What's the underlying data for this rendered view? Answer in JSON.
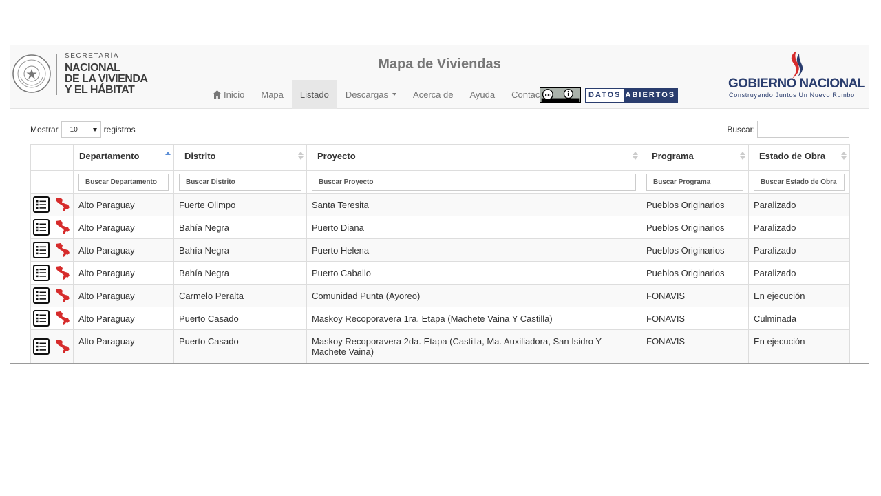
{
  "header": {
    "logo_small": "SECRETARÍA",
    "logo_line1": "NACIONAL",
    "logo_line2": "DE LA VIVIENDA",
    "logo_line3": "Y EL HÁBITAT",
    "title": "Mapa de Viviendas",
    "gob_logo_text": "GOBIERNO NACIONAL",
    "gob_logo_sub": "Construyendo Juntos Un Nuevo Rumbo",
    "datos_1": "DATOS",
    "datos_2": "ABIERTOS"
  },
  "nav": {
    "inicio": "Inicio",
    "mapa": "Mapa",
    "listado": "Listado",
    "descargas": "Descargas",
    "acerca": "Acerca de",
    "ayuda": "Ayuda",
    "contacto": "Contacto"
  },
  "controls": {
    "show_label": "Mostrar",
    "show_value": "10",
    "records_label": "registros",
    "search_label": "Buscar:"
  },
  "table": {
    "headers": [
      "Departamento",
      "Distrito",
      "Proyecto",
      "Programa",
      "Estado de Obra"
    ],
    "search_placeholders": [
      "Buscar Departamento",
      "Buscar Distrito",
      "Buscar Proyecto",
      "Buscar Programa",
      "Buscar Estado de Obra"
    ],
    "rows": [
      {
        "departamento": "Alto Paraguay",
        "distrito": "Fuerte Olimpo",
        "proyecto": "Santa Teresita",
        "programa": "Pueblos Originarios",
        "estado": "Paralizado"
      },
      {
        "departamento": "Alto Paraguay",
        "distrito": "Bahía Negra",
        "proyecto": "Puerto Diana",
        "programa": "Pueblos Originarios",
        "estado": "Paralizado"
      },
      {
        "departamento": "Alto Paraguay",
        "distrito": "Bahía Negra",
        "proyecto": "Puerto Helena",
        "programa": "Pueblos Originarios",
        "estado": "Paralizado"
      },
      {
        "departamento": "Alto Paraguay",
        "distrito": "Bahía Negra",
        "proyecto": "Puerto Caballo",
        "programa": "Pueblos Originarios",
        "estado": "Paralizado"
      },
      {
        "departamento": "Alto Paraguay",
        "distrito": "Carmelo Peralta",
        "proyecto": "Comunidad Punta (Ayoreo)",
        "programa": "FONAVIS",
        "estado": "En ejecución"
      },
      {
        "departamento": "Alto Paraguay",
        "distrito": "Puerto Casado",
        "proyecto": "Maskoy Recoporavera 1ra. Etapa (Machete Vaina Y Castilla)",
        "programa": "FONAVIS",
        "estado": "Culminada"
      },
      {
        "departamento": "Alto Paraguay",
        "distrito": "Puerto Casado",
        "proyecto": "Maskoy Recoporavera 2da. Etapa (Castilla, Ma. Auxiliadora, San Isidro Y Machete Vaina)",
        "programa": "FONAVIS",
        "estado": "En ejecución"
      }
    ]
  },
  "icons": {
    "detail": "list-icon",
    "map": "paraguay-map-icon",
    "home": "home-icon",
    "cc": "creative-commons-icon"
  },
  "colors": {
    "brand_blue": "#2a3d6e",
    "brand_red": "#d62c2c",
    "nav_active": "#e7e7e7",
    "header_bg": "#f8f8f8"
  }
}
